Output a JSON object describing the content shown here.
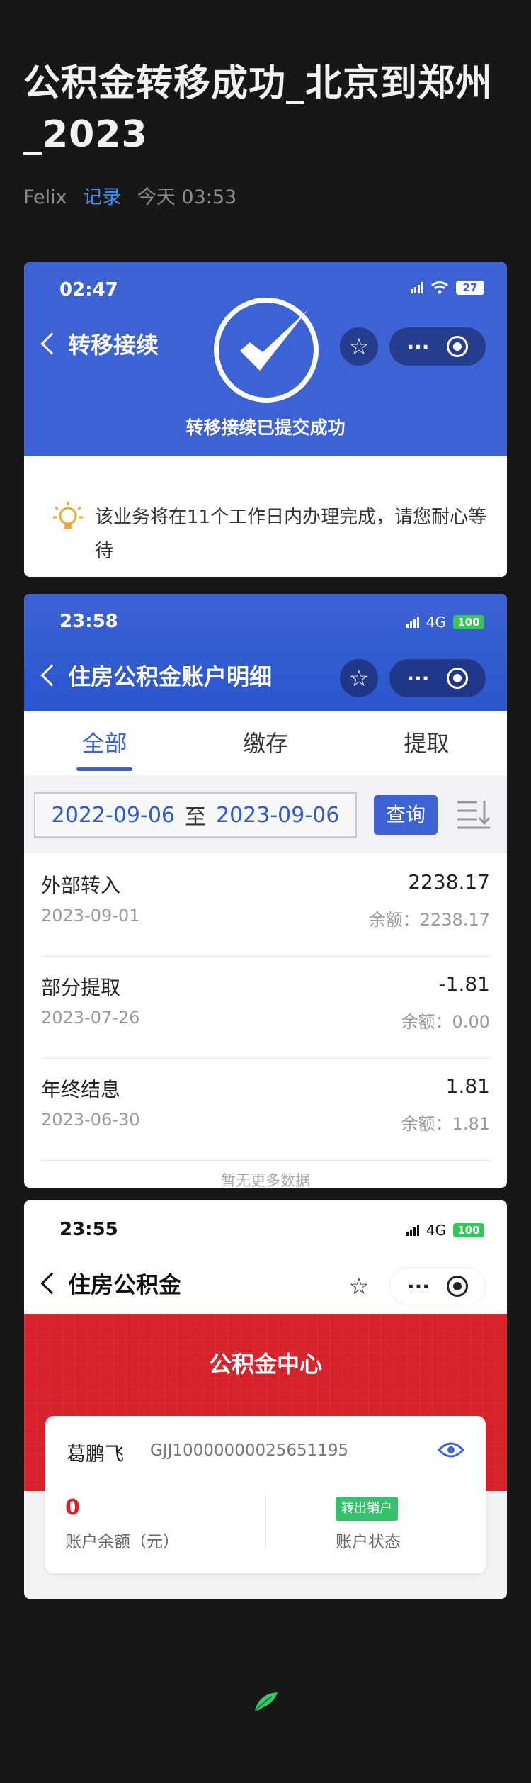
{
  "post": {
    "title": "公积金转移成功_北京到郑州_2023",
    "author": "Felix",
    "tag": "记录",
    "time": "今天 03:53"
  },
  "card1": {
    "status_time": "02:47",
    "battery": "27",
    "nav_title": "转移接续",
    "success_text": "转移接续已提交成功",
    "tip_text": "该业务将在11个工作日内办理完成，请您耐心等待",
    "icons": [
      "chevron-left-icon",
      "check-circle-icon",
      "star-icon",
      "more-icon",
      "target-icon",
      "lightbulb-icon",
      "wifi-icon",
      "signal-icon"
    ]
  },
  "card2": {
    "status_time": "23:58",
    "network": "4G",
    "battery": "100",
    "nav_title": "住房公积金账户明细",
    "tabs": [
      "全部",
      "缴存",
      "提取"
    ],
    "date_from": "2022-09-06",
    "date_sep": "至",
    "date_to": "2023-09-06",
    "query_label": "查询",
    "transactions": [
      {
        "type": "外部转入",
        "amount": "2238.17",
        "date": "2023-09-01",
        "balance": "余额：2238.17"
      },
      {
        "type": "部分提取",
        "amount": "-1.81",
        "date": "2023-07-26",
        "balance": "余额：0.00"
      },
      {
        "type": "年终结息",
        "amount": "1.81",
        "date": "2023-06-30",
        "balance": "余额：1.81"
      }
    ],
    "no_more": "暂无更多数据"
  },
  "card3": {
    "status_time": "23:55",
    "network": "4G",
    "battery": "100",
    "nav_title": "住房公积金",
    "center_title": "公积金中心",
    "account_name": "葛鹏飞",
    "account_no": "GJJ10000000025651195",
    "balance_value": "0",
    "balance_label": "账户余额（元）",
    "status_badge": "转出销户",
    "status_label": "账户状态"
  },
  "colors": {
    "page_bg": "#171717",
    "blue": "#3c62d4",
    "red": "#d7222c",
    "link": "#3f8ef2",
    "green": "#35c759"
  }
}
